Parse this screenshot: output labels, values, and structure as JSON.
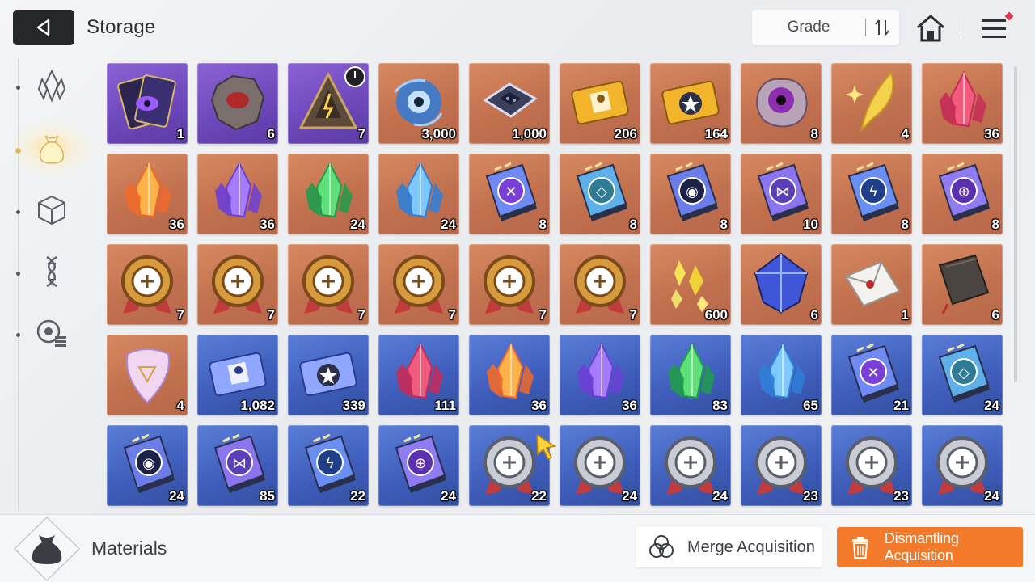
{
  "header": {
    "title": "Storage",
    "grade_label": "Grade"
  },
  "icons": {
    "back": "back-arrow-icon",
    "sort": "sort-toggle-icon",
    "home": "home-icon",
    "menu": "menu-icon"
  },
  "sidebar": {
    "items": [
      {
        "icon": "crystal-category-icon",
        "active": false
      },
      {
        "icon": "materials-bag-icon",
        "active": true
      },
      {
        "icon": "cube-category-icon",
        "active": false
      },
      {
        "icon": "dna-category-icon",
        "active": false
      },
      {
        "icon": "list-category-icon",
        "active": false
      }
    ]
  },
  "grid": {
    "items": [
      {
        "grade": "purple",
        "art": "cards",
        "count": "1"
      },
      {
        "grade": "purple",
        "art": "rock",
        "count": "6"
      },
      {
        "grade": "purple",
        "art": "pyramid",
        "count": "7",
        "timer": true
      },
      {
        "grade": "orange",
        "art": "orb",
        "count": "3,000"
      },
      {
        "grade": "orange",
        "art": "chip",
        "count": "1,000"
      },
      {
        "grade": "orange",
        "art": "ticket",
        "count": "206"
      },
      {
        "grade": "orange",
        "art": "ticket-star",
        "count": "164"
      },
      {
        "grade": "orange",
        "art": "eye",
        "count": "8"
      },
      {
        "grade": "orange",
        "art": "feather",
        "count": "4"
      },
      {
        "grade": "orange",
        "art": "crystal-pink",
        "count": "36"
      },
      {
        "grade": "orange",
        "art": "crystal-orange",
        "count": "36"
      },
      {
        "grade": "orange",
        "art": "crystal-purple",
        "count": "36"
      },
      {
        "grade": "orange",
        "art": "crystal-green",
        "count": "24"
      },
      {
        "grade": "orange",
        "art": "crystal-blue",
        "count": "24"
      },
      {
        "grade": "orange",
        "art": "book-sword",
        "count": "8"
      },
      {
        "grade": "orange",
        "art": "book-shield",
        "count": "8"
      },
      {
        "grade": "orange",
        "art": "book-eye",
        "count": "8"
      },
      {
        "grade": "orange",
        "art": "book-wing",
        "count": "10"
      },
      {
        "grade": "orange",
        "art": "book-bolt",
        "count": "8"
      },
      {
        "grade": "orange",
        "art": "book-ring",
        "count": "8"
      },
      {
        "grade": "orange",
        "art": "medal-gold",
        "count": "7"
      },
      {
        "grade": "orange",
        "art": "medal-gold",
        "count": "7"
      },
      {
        "grade": "orange",
        "art": "medal-gold",
        "count": "7"
      },
      {
        "grade": "orange",
        "art": "medal-gold",
        "count": "7"
      },
      {
        "grade": "orange",
        "art": "medal-gold",
        "count": "7"
      },
      {
        "grade": "orange",
        "art": "medal-gold",
        "count": "7"
      },
      {
        "grade": "orange",
        "art": "shards",
        "count": "600"
      },
      {
        "grade": "orange",
        "art": "cube-gem",
        "count": "6"
      },
      {
        "grade": "orange",
        "art": "envelope",
        "count": "1"
      },
      {
        "grade": "orange",
        "art": "notebook",
        "count": "6"
      },
      {
        "grade": "orange",
        "art": "pick",
        "count": "4"
      },
      {
        "grade": "blue",
        "art": "ticket-blue",
        "count": "1,082"
      },
      {
        "grade": "blue",
        "art": "ticket-blue-star",
        "count": "339"
      },
      {
        "grade": "blue",
        "art": "crystal-pink",
        "count": "111"
      },
      {
        "grade": "blue",
        "art": "crystal-orange",
        "count": "36"
      },
      {
        "grade": "blue",
        "art": "crystal-purple",
        "count": "36"
      },
      {
        "grade": "blue",
        "art": "crystal-green",
        "count": "83"
      },
      {
        "grade": "blue",
        "art": "crystal-blue",
        "count": "65"
      },
      {
        "grade": "blue",
        "art": "book-sword",
        "count": "21"
      },
      {
        "grade": "blue",
        "art": "book-shield",
        "count": "24"
      },
      {
        "grade": "blue",
        "art": "book-eye",
        "count": "24"
      },
      {
        "grade": "blue",
        "art": "book-wing",
        "count": "85"
      },
      {
        "grade": "blue",
        "art": "book-bolt",
        "count": "22"
      },
      {
        "grade": "blue",
        "art": "book-ring",
        "count": "24"
      },
      {
        "grade": "blue",
        "art": "medal-silver",
        "count": "22"
      },
      {
        "grade": "blue",
        "art": "medal-silver",
        "count": "24"
      },
      {
        "grade": "blue",
        "art": "medal-silver",
        "count": "24"
      },
      {
        "grade": "blue",
        "art": "medal-silver",
        "count": "23"
      },
      {
        "grade": "blue",
        "art": "medal-silver",
        "count": "23"
      },
      {
        "grade": "blue",
        "art": "medal-silver",
        "count": "24"
      }
    ]
  },
  "footer": {
    "category_label": "Materials",
    "category_icon": "materials-bag-icon",
    "merge_label": "Merge Acquisition",
    "merge_icon": "merge-circles-icon",
    "dismantle_label": "Dismantling Acquisition",
    "dismantle_icon": "trash-icon"
  },
  "colors": {
    "accent": "#f27a2a",
    "grade_orange": "#c2714f",
    "grade_purple": "#6c47b8",
    "grade_blue": "#3e5cba",
    "dark_button": "#25272b"
  }
}
